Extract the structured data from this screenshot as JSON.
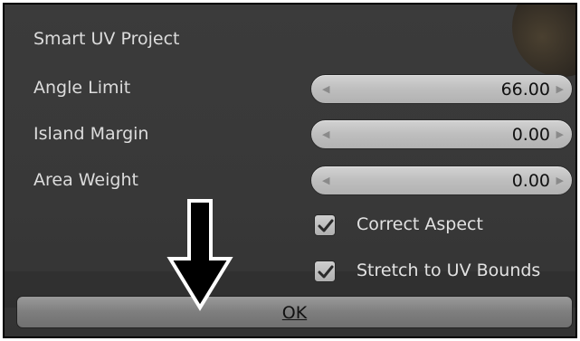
{
  "operator": {
    "title": "Smart UV Project",
    "fields": [
      {
        "label": "Angle Limit",
        "value": "66.00"
      },
      {
        "label": "Island Margin",
        "value": "0.00"
      },
      {
        "label": "Area Weight",
        "value": "0.00"
      }
    ],
    "checkboxes": [
      {
        "label": "Correct Aspect",
        "checked": true
      },
      {
        "label": "Stretch to UV Bounds",
        "checked": true
      }
    ],
    "ok_label": "OK"
  },
  "icons": {
    "decrement": "left-arrow-icon",
    "increment": "right-arrow-icon",
    "check": "check-icon",
    "annotation": "down-arrow-icon"
  },
  "colors": {
    "panel_bg": "#3a3a3a",
    "text": "#dcdcdc",
    "field_bg": "#c4c4c4",
    "button_bg": "#808080"
  }
}
